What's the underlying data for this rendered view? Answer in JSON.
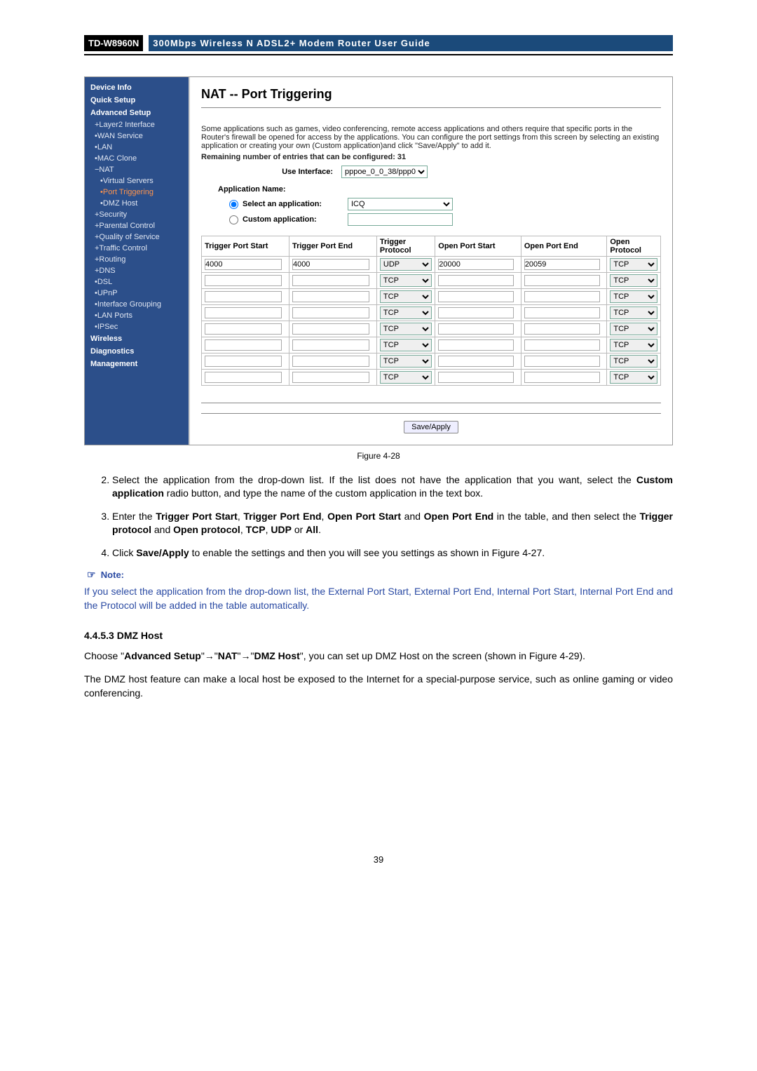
{
  "header": {
    "model": "TD-W8960N",
    "title": "300Mbps Wireless N ADSL2+ Modem Router User Guide"
  },
  "sidebar": {
    "top": [
      "Device Info",
      "Quick Setup",
      "Advanced Setup"
    ],
    "adv": [
      {
        "t": "+Layer2 Interface",
        "k": "layer2"
      },
      {
        "t": "•WAN Service",
        "k": "wan"
      },
      {
        "t": "•LAN",
        "k": "lan"
      },
      {
        "t": "•MAC Clone",
        "k": "mac"
      },
      {
        "t": "−NAT",
        "k": "nat"
      },
      {
        "t": "•Virtual Servers",
        "k": "vs",
        "sub": true
      },
      {
        "t": "•Port Triggering",
        "k": "pt",
        "sub": true,
        "active": true
      },
      {
        "t": "•DMZ Host",
        "k": "dmz",
        "sub": true
      },
      {
        "t": "+Security",
        "k": "sec"
      },
      {
        "t": "+Parental Control",
        "k": "pc"
      },
      {
        "t": "+Quality of Service",
        "k": "qos"
      },
      {
        "t": "+Traffic Control",
        "k": "tc"
      },
      {
        "t": "+Routing",
        "k": "rt"
      },
      {
        "t": "+DNS",
        "k": "dns"
      },
      {
        "t": "•DSL",
        "k": "dsl"
      },
      {
        "t": "•UPnP",
        "k": "upnp"
      },
      {
        "t": "•Interface Grouping",
        "k": "ig"
      },
      {
        "t": "•LAN Ports",
        "k": "lp"
      },
      {
        "t": "•IPSec",
        "k": "ips"
      }
    ],
    "bottom": [
      "Wireless",
      "Diagnostics",
      "Management"
    ]
  },
  "content": {
    "heading": "NAT -- Port Triggering",
    "desc1": "Some applications such as games, video conferencing, remote access applications and others require that specific ports in the Router's firewall be opened for access by the applications. You can configure the port settings from this screen by selecting an existing application or creating your own (Custom application)and click \"Save/Apply\" to add it.",
    "remaining": "Remaining number of entries that can be configured: 31",
    "use_interface_label": "Use Interface:",
    "interface_value": "pppoe_0_0_38/ppp0",
    "app_name_label": "Application Name:",
    "sel_app_label": "Select an application:",
    "sel_app_value": "ICQ",
    "custom_app_label": "Custom application:",
    "cols": [
      "Trigger Port Start",
      "Trigger Port End",
      "Trigger Protocol",
      "Open Port Start",
      "Open Port End",
      "Open Protocol"
    ],
    "rows": [
      {
        "tps": "4000",
        "tpe": "4000",
        "tp": "UDP",
        "ops": "20000",
        "ope": "20059",
        "op": "TCP"
      },
      {
        "tps": "",
        "tpe": "",
        "tp": "TCP",
        "ops": "",
        "ope": "",
        "op": "TCP"
      },
      {
        "tps": "",
        "tpe": "",
        "tp": "TCP",
        "ops": "",
        "ope": "",
        "op": "TCP"
      },
      {
        "tps": "",
        "tpe": "",
        "tp": "TCP",
        "ops": "",
        "ope": "",
        "op": "TCP"
      },
      {
        "tps": "",
        "tpe": "",
        "tp": "TCP",
        "ops": "",
        "ope": "",
        "op": "TCP"
      },
      {
        "tps": "",
        "tpe": "",
        "tp": "TCP",
        "ops": "",
        "ope": "",
        "op": "TCP"
      },
      {
        "tps": "",
        "tpe": "",
        "tp": "TCP",
        "ops": "",
        "ope": "",
        "op": "TCP"
      },
      {
        "tps": "",
        "tpe": "",
        "tp": "TCP",
        "ops": "",
        "ope": "",
        "op": "TCP"
      }
    ],
    "save_label": "Save/Apply"
  },
  "figcaption": "Figure 4-28",
  "steps": {
    "s2a": "Select the application from the drop-down list. If the list does not have the application that you want, select the ",
    "s2b": "Custom application",
    "s2c": " radio button, and type the name of the custom application in the text box.",
    "s3a": "Enter the ",
    "s3b": "Trigger Port Start",
    "s3c": ", ",
    "s3d": "Trigger Port End",
    "s3e": ", ",
    "s3f": "Open Port Start",
    "s3g": " and ",
    "s3h": "Open Port End",
    "s3i": " in the table, and then select the ",
    "s3j": "Trigger protocol",
    "s3k": " and ",
    "s3l": "Open protocol",
    "s3m": ", ",
    "s3n": "TCP",
    "s3o": ", ",
    "s3p": "UDP",
    "s3q": " or ",
    "s3r": "All",
    "s3s": ".",
    "s4a": "Click ",
    "s4b": "Save/Apply",
    "s4c": " to enable the settings and then you will see you settings as shown in Figure 4-27."
  },
  "note": {
    "label": "Note:",
    "text": "If you select the application from the drop-down list, the External Port Start, External Port End, Internal Port Start, Internal Port End and the Protocol will be added in the table automatically."
  },
  "section": {
    "heading": "4.4.5.3  DMZ Host",
    "p1a": "Choose \"",
    "p1b": "Advanced Setup",
    "p1c": "\"→\"",
    "p1d": "NAT",
    "p1e": "\"→\"",
    "p1f": "DMZ Host",
    "p1g": "\", you can set up DMZ Host on the screen (shown in Figure 4-29).",
    "p2": "The DMZ host feature can make a local host be exposed to the Internet for a special-purpose service, such as online gaming or video conferencing."
  },
  "pagenum": "39"
}
